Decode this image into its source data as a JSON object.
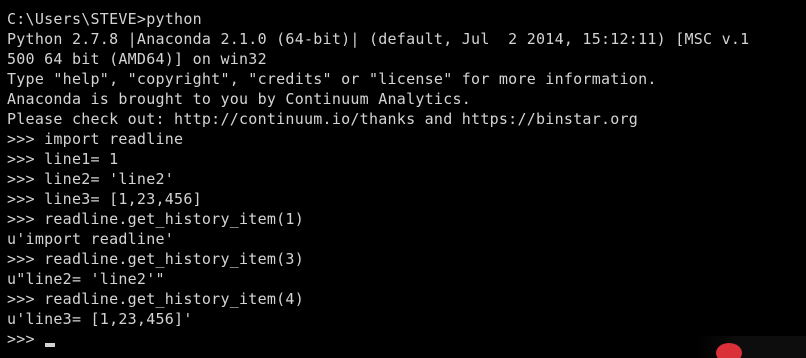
{
  "colors": {
    "background": "#000000",
    "text": "#d4d4d4",
    "watermark_logo": "#d9303a"
  },
  "console": {
    "lines": [
      "C:\\Users\\STEVE>python",
      "Python 2.7.8 |Anaconda 2.1.0 (64-bit)| (default, Jul  2 2014, 15:12:11) [MSC v.1",
      "500 64 bit (AMD64)] on win32",
      "Type \"help\", \"copyright\", \"credits\" or \"license\" for more information.",
      "Anaconda is brought to you by Continuum Analytics.",
      "Please check out: http://continuum.io/thanks and https://binstar.org",
      ">>> import readline",
      ">>> line1= 1",
      ">>> line2= 'line2'",
      ">>> line3= [1,23,456]",
      ">>> readline.get_history_item(1)",
      "u'import readline'",
      ">>> readline.get_history_item(3)",
      "u\"line2= 'line2'\"",
      ">>> readline.get_history_item(4)",
      "u'line3= [1,23,456]'"
    ],
    "prompt": ">>> "
  }
}
